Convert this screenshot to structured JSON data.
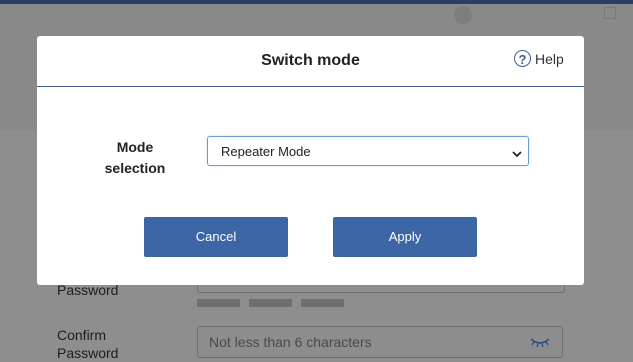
{
  "background": {
    "password_label": "Password",
    "confirm_label_line1": "Confirm",
    "confirm_label_line2": "Password",
    "confirm_placeholder": "Not less than 6 characters"
  },
  "modal": {
    "title": "Switch mode",
    "help_label": "Help",
    "help_icon": "question-circle-icon",
    "mode_label_line1": "Mode",
    "mode_label_line2": "selection",
    "selected_mode": "Repeater Mode",
    "cancel_label": "Cancel",
    "apply_label": "Apply"
  },
  "colors": {
    "accent": "#3c65a6",
    "overlay": "#8a8a8a"
  }
}
